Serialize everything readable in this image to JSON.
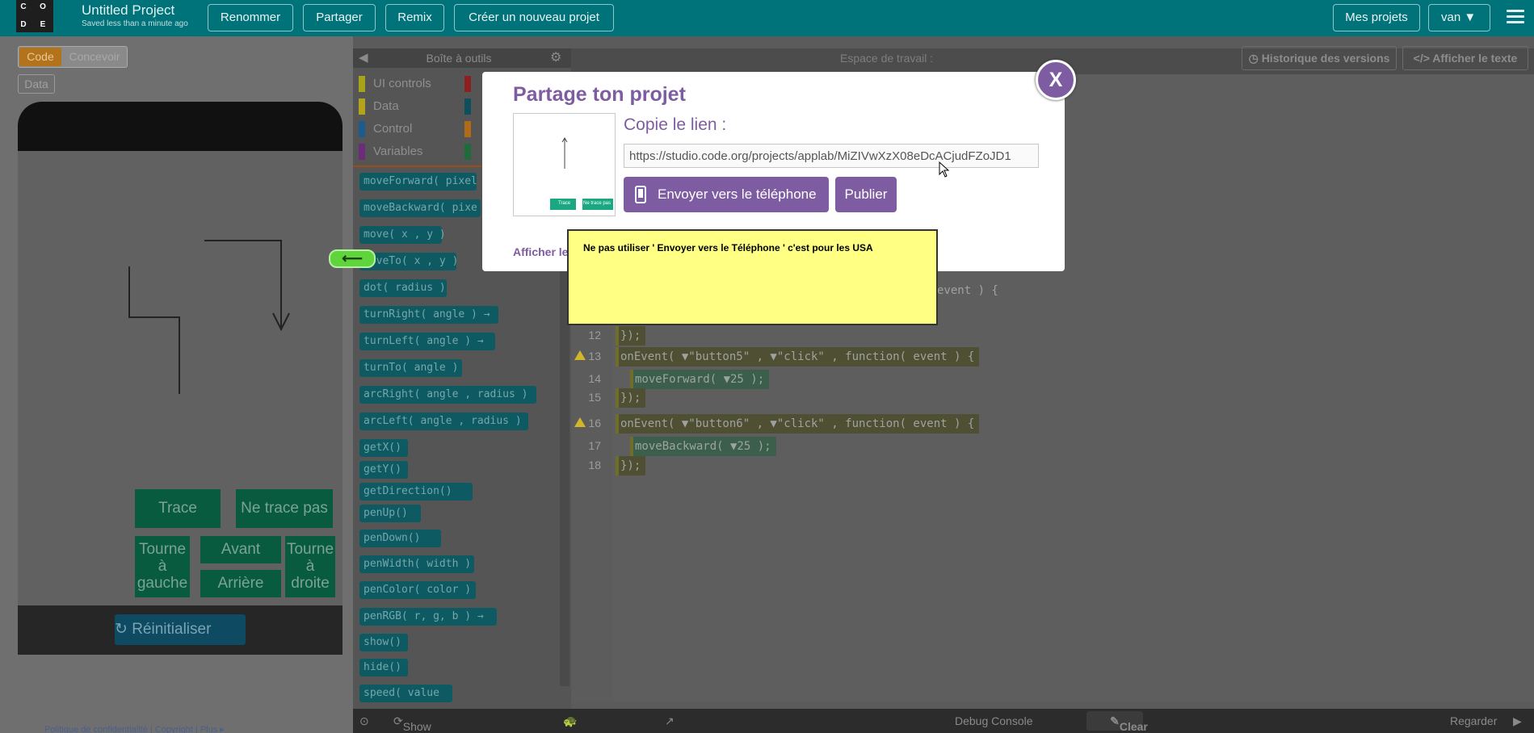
{
  "header": {
    "project_title": "Untitled Project",
    "save_status": "Saved less than a minute ago",
    "buttons": [
      "Renommer",
      "Partager",
      "Remix",
      "Créer un nouveau projet"
    ],
    "my_projects": "Mes projets",
    "user": "van",
    "logo_letters": [
      "C",
      "O",
      "D",
      "E"
    ]
  },
  "left": {
    "tab_code": "Code",
    "tab_design": "Concevoir",
    "data_btn": "Data",
    "app_buttons": [
      "Trace",
      "Ne trace pas",
      "Tourne à gauche",
      "Avant",
      "Tourne à droite",
      "Arrière"
    ],
    "reset": "Réinitialiser",
    "footer": "Politique de confidentialité | Copyright | Plus ▸"
  },
  "toolbox": {
    "title": "Boîte à outils",
    "categories": [
      {
        "label": "UI controls",
        "color": "#a6a21a"
      },
      {
        "label": "Data",
        "color": "#b2a41c"
      },
      {
        "label": "Control",
        "color": "#1f5a8c"
      },
      {
        "label": "Variables",
        "color": "#6a2d78"
      }
    ],
    "blocks": [
      "moveForward( pixel",
      "moveBackward( pixe",
      "move( x , y )",
      "moveTo( x , y )",
      "dot( radius )",
      "turnRight( angle ) →",
      "turnLeft( angle ) →",
      "turnTo( angle )",
      "arcRight( angle , radius )",
      "arcLeft( angle , radius )",
      "getX()",
      "getY()",
      "getDirection()",
      "penUp()",
      "penDown()",
      "penWidth( width )",
      "penColor( color )",
      "penRGB( r, g, b ) →",
      "show()",
      "hide()",
      "speed( value"
    ]
  },
  "workspace": {
    "title": "Espace de travail :",
    "history": "Historique des versions",
    "show_text": "Afficher le texte",
    "code_lines": [
      {
        "n": "12",
        "text": "});",
        "warn": false
      },
      {
        "n": "13",
        "text": "onEvent( ▼\"button5\" , ▼\"click\" , function( event ) {",
        "warn": true
      },
      {
        "n": "14",
        "text": "  moveForward( ▼25 );",
        "warn": false
      },
      {
        "n": "15",
        "text": "});",
        "warn": false
      },
      {
        "n": "16",
        "text": "onEvent( ▼\"button6\" , ▼\"click\" , function( event ) {",
        "warn": true
      },
      {
        "n": "17",
        "text": "  moveBackward( ▼25 );",
        "warn": false
      },
      {
        "n": "18",
        "text": "});",
        "warn": false
      }
    ],
    "partial_line": "event ) {"
  },
  "debug": {
    "show_cmds": "Show Debug Commands",
    "console": "Debug Console",
    "clear": "Clear",
    "watch": "Regarder"
  },
  "dialog": {
    "title": "Partage ton projet",
    "close": "X",
    "copy_label": "Copie le lien :",
    "link": "https://studio.code.org/projects/applab/MiZIVwXzX08eDcACjudFZoJD1",
    "send_phone": "Envoyer vers le téléphone",
    "publish": "Publier",
    "show_more": "Afficher le",
    "thumb_buttons": [
      "Trace",
      "Ne trace pas"
    ]
  },
  "annotation": {
    "note": "Ne pas utiliser ' Envoyer vers le Téléphone ' c'est pour les USA",
    "arrow": "⟵"
  }
}
